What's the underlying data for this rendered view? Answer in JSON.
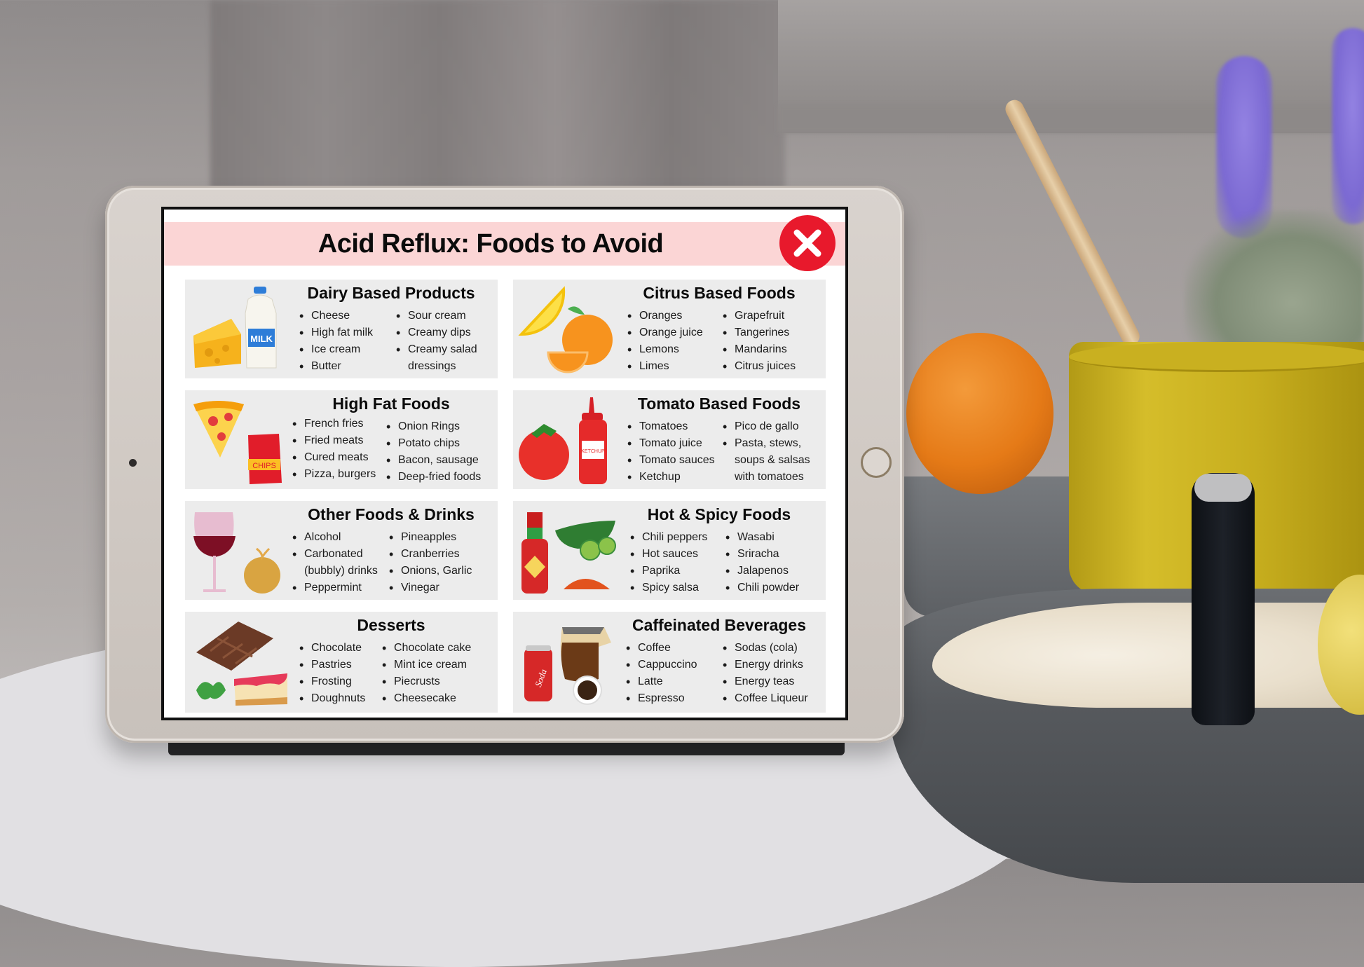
{
  "scene": {
    "description_objects": [
      "tablet",
      "orange",
      "yellow mug",
      "wooden stick",
      "lavender",
      "yogurt bowl",
      "black spoon"
    ]
  },
  "infographic": {
    "title": "Acid Reflux: Foods to Avoid",
    "badge_icon": "close-x-icon",
    "colors": {
      "header_band": "#fbd5d5",
      "badge": "#e8192c",
      "card_bg": "#ececec",
      "text": "#0b0b0b"
    },
    "sections": [
      {
        "heading": "Dairy Based Products",
        "icons": [
          "cheese-icon",
          "milk-jug-icon"
        ],
        "illustration_label": "MILK",
        "col1": [
          "Cheese",
          "High fat milk",
          "Ice cream",
          "Butter"
        ],
        "col2": [
          "Sour cream",
          "Creamy dips",
          "Creamy salad",
          "dressings"
        ]
      },
      {
        "heading": "Citrus Based Foods",
        "icons": [
          "lemon-slice-icon",
          "orange-icon"
        ],
        "col1": [
          "Oranges",
          "Orange juice",
          "Lemons",
          "Limes"
        ],
        "col2": [
          "Grapefruit",
          "Tangerines",
          "Mandarins",
          "Citrus juices"
        ]
      },
      {
        "heading": "High Fat Foods",
        "icons": [
          "pizza-slice-icon",
          "chips-bag-icon"
        ],
        "illustration_label": "CHIPS",
        "col1": [
          "French fries",
          "Fried meats",
          "Cured meats",
          "Pizza, burgers"
        ],
        "col2": [
          "Onion Rings",
          "Potato chips",
          "Bacon, sausage",
          "Deep-fried foods"
        ]
      },
      {
        "heading": "Tomato Based Foods",
        "icons": [
          "tomato-icon",
          "ketchup-bottle-icon"
        ],
        "illustration_label": "KETCHUP",
        "col1": [
          "Tomatoes",
          "Tomato juice",
          "Tomato sauces",
          "Ketchup"
        ],
        "col2": [
          "Pico de gallo",
          "Pasta, stews,",
          "soups & salsas",
          "with tomatoes"
        ]
      },
      {
        "heading": "Other Foods & Drinks",
        "icons": [
          "wine-glass-icon",
          "onion-icon"
        ],
        "col1": [
          "Alcohol",
          "Carbonated",
          "(bubbly) drinks",
          "Peppermint"
        ],
        "col2": [
          "Pineapples",
          "Cranberries",
          "Onions, Garlic",
          "Vinegar"
        ]
      },
      {
        "heading": "Hot & Spicy Foods",
        "icons": [
          "hot-sauce-bottle-icon",
          "jalapeno-icon",
          "chili-powder-icon"
        ],
        "col1": [
          "Chili peppers",
          "Hot sauces",
          "Paprika",
          "Spicy salsa"
        ],
        "col2": [
          "Wasabi",
          "Sriracha",
          "Jalapenos",
          "Chili powder"
        ]
      },
      {
        "heading": "Desserts",
        "icons": [
          "chocolate-bar-icon",
          "mint-leaf-icon",
          "cheesecake-icon"
        ],
        "col1": [
          "Chocolate",
          "Pastries",
          "Frosting",
          "Doughnuts"
        ],
        "col2": [
          "Chocolate cake",
          "Mint ice cream",
          "Piecrusts",
          "Cheesecake"
        ]
      },
      {
        "heading": "Caffeinated Beverages",
        "icons": [
          "soda-can-icon",
          "coffee-pot-icon",
          "coffee-cup-icon"
        ],
        "illustration_label": "Soda",
        "col1": [
          "Coffee",
          "Cappuccino",
          "Latte",
          "Espresso"
        ],
        "col2": [
          "Sodas (cola)",
          "Energy drinks",
          "Energy teas",
          "Coffee Liqueur"
        ]
      }
    ]
  }
}
